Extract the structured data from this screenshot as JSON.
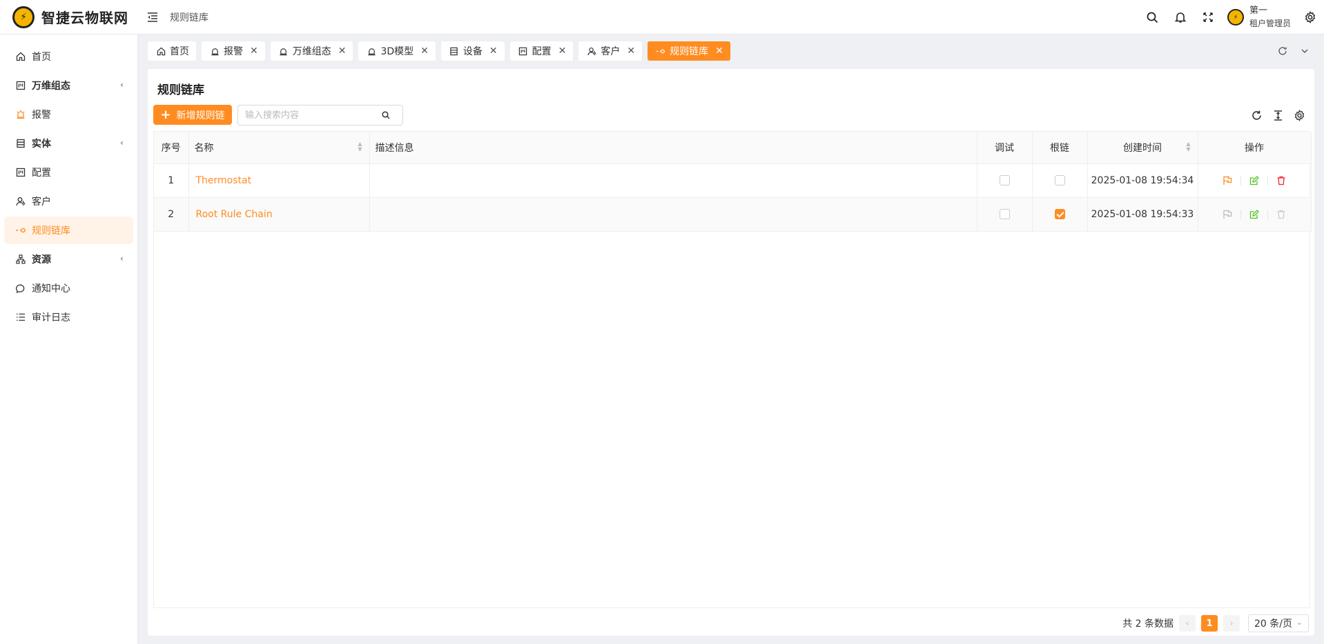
{
  "app": {
    "name": "智捷云物联网",
    "logo_text": "⚡"
  },
  "header": {
    "breadcrumb": "规则链库",
    "user_name": "第一",
    "user_role": "租户管理员"
  },
  "sidebar": {
    "items": [
      {
        "label": "首页",
        "icon": "home-icon"
      },
      {
        "label": "万维组态",
        "icon": "layout-icon",
        "arrow": "‹"
      },
      {
        "label": "报警",
        "icon": "alarm-icon"
      },
      {
        "label": "实体",
        "icon": "entity-icon",
        "arrow": "‹"
      },
      {
        "label": "配置",
        "icon": "config-icon"
      },
      {
        "label": "客户",
        "icon": "customer-icon"
      },
      {
        "label": "规则链库",
        "icon": "rule-chain-icon"
      },
      {
        "label": "资源",
        "icon": "resource-icon",
        "arrow": "‹"
      },
      {
        "label": "通知中心",
        "icon": "notification-icon"
      },
      {
        "label": "审计日志",
        "icon": "audit-log-icon"
      }
    ]
  },
  "tabs": [
    {
      "label": "首页"
    },
    {
      "label": "报警"
    },
    {
      "label": "万维组态"
    },
    {
      "label": "3D模型"
    },
    {
      "label": "设备"
    },
    {
      "label": "配置"
    },
    {
      "label": "客户"
    },
    {
      "label": "规则链库"
    }
  ],
  "panel": {
    "title": "规则链库",
    "add_button": "新增规则链",
    "search_placeholder": "输入搜索内容"
  },
  "table": {
    "columns": [
      "序号",
      "名称",
      "描述信息",
      "调试",
      "根链",
      "创建时间",
      "操作"
    ],
    "rows": [
      {
        "index": "1",
        "name": "Thermostat",
        "description": "",
        "debug": false,
        "root": false,
        "created": "2025-01-08 19:54:34"
      },
      {
        "index": "2",
        "name": "Root Rule Chain",
        "description": "",
        "debug": false,
        "root": true,
        "created": "2025-01-08 19:54:33"
      }
    ]
  },
  "pagination": {
    "total_text": "共 2 条数据",
    "prev": "‹",
    "current": "1",
    "next": "›",
    "page_size": "20 条/页"
  },
  "colors": {
    "accent": "#ff8c21",
    "edit": "#52c41a",
    "delete": "#f5222d",
    "disabled": "#cccccc"
  }
}
